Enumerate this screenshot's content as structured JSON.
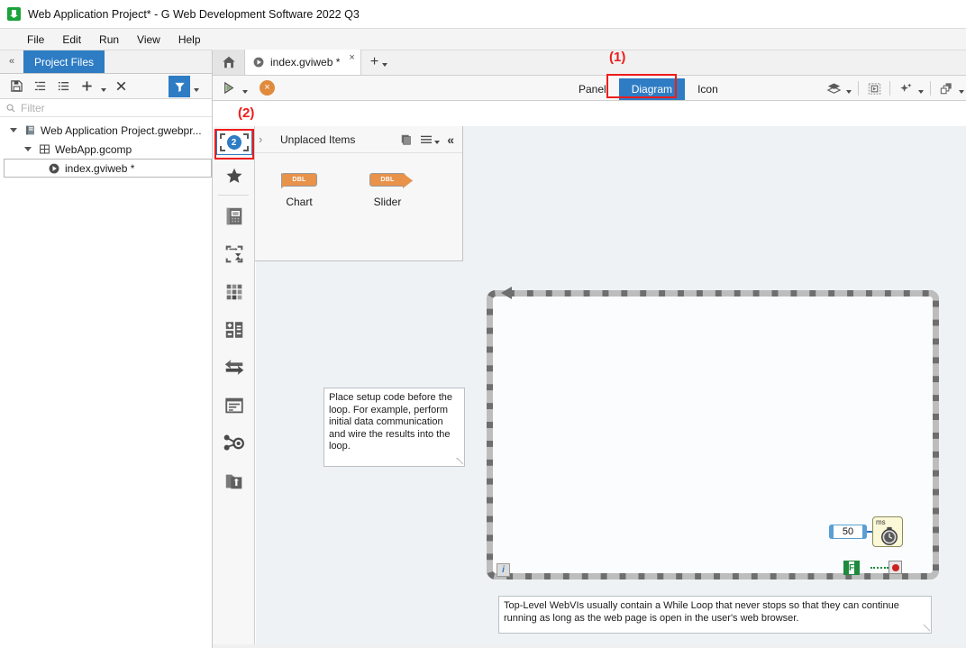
{
  "window": {
    "title": "Web Application Project* - G Web Development Software 2022 Q3",
    "logo_icon": "g-web-logo-icon"
  },
  "menubar": {
    "items": [
      {
        "label": "File"
      },
      {
        "label": "Edit"
      },
      {
        "label": "Run"
      },
      {
        "label": "View"
      },
      {
        "label": "Help"
      }
    ]
  },
  "project_pane": {
    "collapse_icon": "collapse-left-icon",
    "tab_label": "Project Files",
    "toolbar": {
      "save_icon": "save-icon",
      "expand_all_icon": "expand-all-icon",
      "list_icon": "list-view-icon",
      "add_icon": "add-icon",
      "add_caret_icon": "chevron-down-icon",
      "remove_icon": "remove-icon",
      "filter_icon": "filter-funnel-icon",
      "filter_caret_icon": "chevron-down-icon"
    },
    "filter": {
      "search_icon": "search-icon",
      "placeholder": "Filter",
      "value": ""
    },
    "tree": [
      {
        "label": "Web Application Project.gwebpr...",
        "icon": "project-icon",
        "indent": 0,
        "expanded": true,
        "selected": false
      },
      {
        "label": "WebApp.gcomp",
        "icon": "component-icon",
        "indent": 1,
        "expanded": true,
        "selected": false
      },
      {
        "label": "index.gviweb *",
        "icon": "webvi-icon",
        "indent": 2,
        "expanded": null,
        "selected": true
      }
    ]
  },
  "editor": {
    "home_tab_icon": "home-icon",
    "document_tab": {
      "label": "index.gviweb *",
      "icon": "webvi-icon",
      "close_label": "×"
    },
    "add_tab": {
      "label": "+",
      "caret_icon": "chevron-down-icon"
    },
    "toolbar": {
      "run_icon": "run-arrow-icon",
      "run_caret_icon": "chevron-down-icon",
      "abort_icon": "abort-icon",
      "abort_label": "×",
      "layers_icon": "layers-icon",
      "layers_caret_icon": "chevron-down-icon",
      "select_area_icon": "select-area-icon",
      "cleanup_icon": "cleanup-sparkle-icon",
      "cleanup_caret_icon": "chevron-down-icon",
      "arrange_icon": "arrange-icon",
      "arrange_caret_icon": "chevron-down-icon"
    },
    "view_tabs": [
      {
        "label": "Panel",
        "active": false
      },
      {
        "label": "Diagram",
        "active": true
      },
      {
        "label": "Icon",
        "active": false
      }
    ]
  },
  "palette_rail": {
    "unplaced_button": {
      "name": "unplaced-items-button",
      "badge_count": "2",
      "selected": true
    },
    "items": [
      {
        "icon": "favorites-star-icon",
        "label": "Favorites"
      },
      {
        "icon": "data-storage-icon",
        "label": "Data Storage"
      },
      {
        "icon": "execution-structures-icon",
        "label": "Execution Structures"
      },
      {
        "icon": "array-matrix-icon",
        "label": "Array and Matrix"
      },
      {
        "icon": "numeric-icon",
        "label": "Numeric"
      },
      {
        "icon": "comparison-icon",
        "label": "Comparison"
      },
      {
        "icon": "string-icon",
        "label": "String"
      },
      {
        "icon": "cluster-icon",
        "label": "Cluster"
      },
      {
        "icon": "web-resource-icon",
        "label": "Web Resource"
      }
    ]
  },
  "unplaced_panel": {
    "expand_icon": "chevron-right-icon",
    "title": "Unplaced Items",
    "stack_icon": "stack-icon",
    "menu_icon": "hamburger-menu-icon",
    "menu_caret_icon": "chevron-down-icon",
    "collapse_icon": "double-chevron-left-icon",
    "items": [
      {
        "label": "Chart",
        "datatype": "DBL",
        "kind": "indicator"
      },
      {
        "label": "Slider",
        "datatype": "DBL",
        "kind": "control"
      }
    ]
  },
  "diagram": {
    "setup_comment": "Place setup code before the loop. For example, perform initial data communication and wire the results into the loop.",
    "bottom_comment": "Top-Level WebVIs usually contain a While Loop that never stops so that they can continue running as long as the web page is open in the user's web browser.",
    "while_loop": {
      "iteration_terminal": "i",
      "arrow_icon": "loop-direction-arrow-icon"
    },
    "wait_node": {
      "unit_label": "ms",
      "icon": "stopwatch-icon",
      "constant_value": "50"
    },
    "stop_condition": {
      "boolean_constant": "F",
      "terminal_icon": "stop-sign-icon"
    }
  },
  "annotations": [
    {
      "label": "(1)",
      "target": "diagram-view-tab"
    },
    {
      "label": "(2)",
      "target": "unplaced-items-button"
    }
  ],
  "colors": {
    "accent_blue": "#2e7cc4",
    "annotation_red": "#ee1c1c",
    "terminal_orange": "#e8924a",
    "canvas_bg": "#eef2f5",
    "loop_border": "#6e6e6e",
    "boolean_green": "#1f8a3d",
    "wait_node_yellow": "#fbf8d8"
  }
}
